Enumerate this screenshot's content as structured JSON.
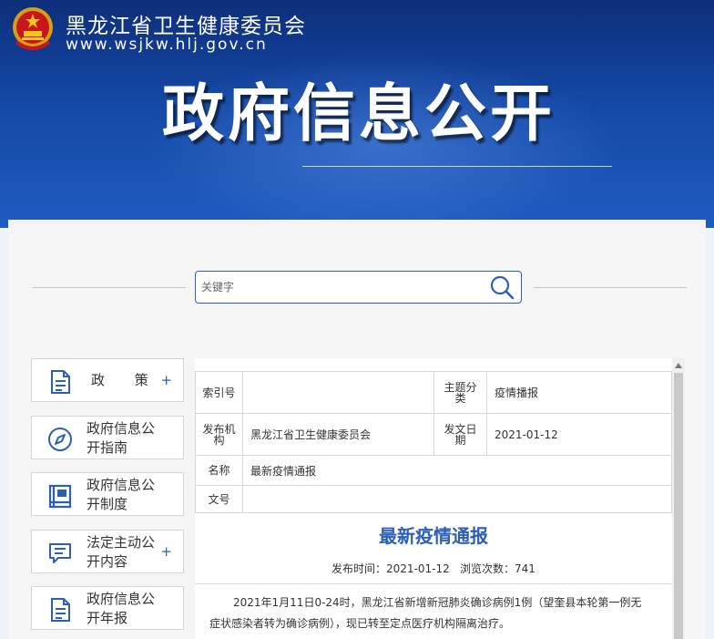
{
  "header": {
    "site_name": "黑龙江省卫生健康委员会",
    "site_url": "www.wsjkw.hlj.gov.cn",
    "hero_title": "政府信息公开"
  },
  "search": {
    "placeholder": "关键字"
  },
  "menu": [
    {
      "label": "政 策",
      "icon": "document-icon",
      "has_plus": true
    },
    {
      "label": "政府信息公开指南",
      "icon": "compass-icon",
      "has_plus": false
    },
    {
      "label": "政府信息公开制度",
      "icon": "book-icon",
      "has_plus": false
    },
    {
      "label": "法定主动公开内容",
      "icon": "message-icon",
      "has_plus": true
    },
    {
      "label": "政府信息公开年报",
      "icon": "report-icon",
      "has_plus": false
    }
  ],
  "meta": {
    "index_no_label": "索引号",
    "index_no": "",
    "topic_label": "主题分类",
    "topic": "疫情播报",
    "publisher_label": "发布机构",
    "publisher": "黑龙江省卫生健康委员会",
    "issue_date_label": "发文日期",
    "issue_date": "2021-01-12",
    "name_label": "名称",
    "name": "最新疫情通报",
    "doc_no_label": "文号",
    "doc_no": ""
  },
  "article": {
    "title": "最新疫情通报",
    "publish_time": "发布时间：2021-01-12",
    "views": "浏览次数：741",
    "body": "2021年1月11日0-24时，黑龙江省新增新冠肺炎确诊病例1例（望奎县本轮第一例无症状感染者转为确诊病例），现已转至定点医疗机构隔离治疗。"
  },
  "colors": {
    "brand_blue": "#2b5fb8",
    "banner_dark": "#0d2f7a"
  }
}
